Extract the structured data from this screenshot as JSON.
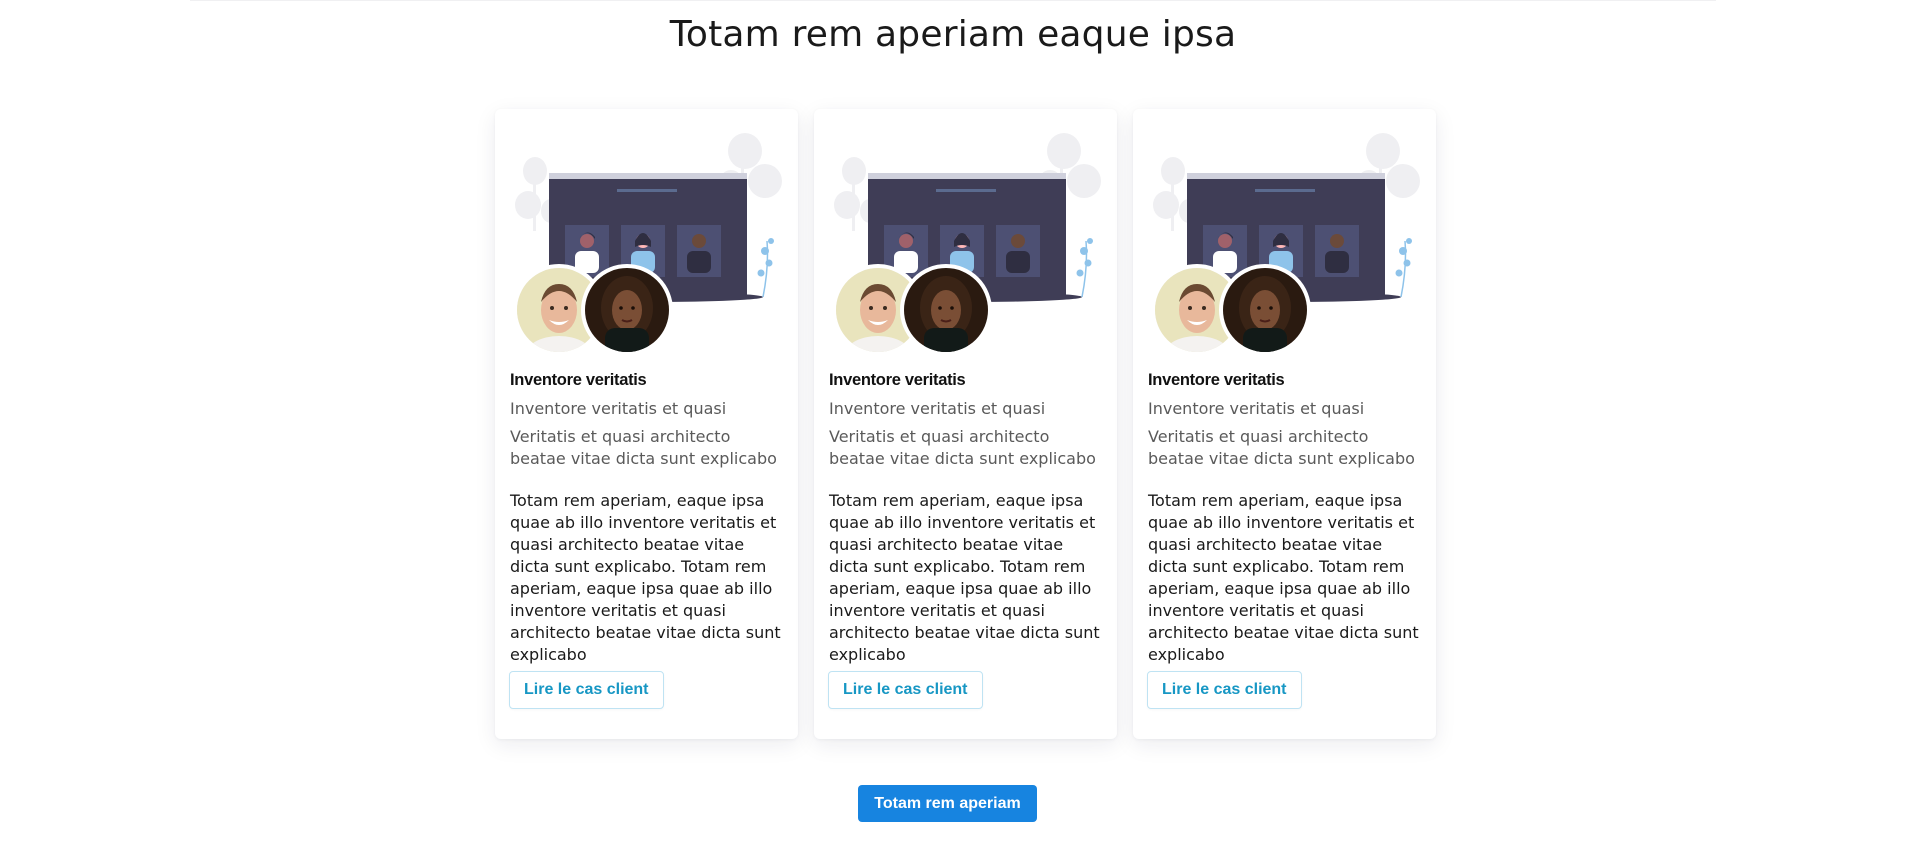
{
  "section": {
    "title": "Totam rem aperiam eaque ipsa"
  },
  "cards": [
    {
      "title": "Inventore veritatis",
      "subtitle": "Inventore veritatis et quasi",
      "tagline": "Veritatis et quasi architecto beatae vitae dicta sunt explicabo",
      "body": "Totam rem aperiam, eaque ipsa quae ab illo inventore veritatis et quasi architecto beatae vitae dicta sunt explicabo. Totam rem aperiam, eaque ipsa quae ab illo inventore veritatis et quasi architecto beatae vitae dicta sunt explicabo",
      "button_label": "Lire le cas client"
    },
    {
      "title": "Inventore veritatis",
      "subtitle": "Inventore veritatis et quasi",
      "tagline": "Veritatis et quasi architecto beatae vitae dicta sunt explicabo",
      "body": "Totam rem aperiam, eaque ipsa quae ab illo inventore veritatis et quasi architecto beatae vitae dicta sunt explicabo. Totam rem aperiam, eaque ipsa quae ab illo inventore veritatis et quasi architecto beatae vitae dicta sunt explicabo",
      "button_label": "Lire le cas client"
    },
    {
      "title": "Inventore veritatis",
      "subtitle": "Inventore veritatis et quasi",
      "tagline": "Veritatis et quasi architecto beatae vitae dicta sunt explicabo",
      "body": "Totam rem aperiam, eaque ipsa quae ab illo inventore veritatis et quasi architecto beatae vitae dicta sunt explicabo. Totam rem aperiam, eaque ipsa quae ab illo inventore veritatis et quasi architecto beatae vitae dicta sunt explicabo",
      "button_label": "Lire le cas client"
    }
  ],
  "primary_cta": {
    "label": "Totam rem aperiam"
  },
  "colors": {
    "card_button_text": "#1797c4",
    "card_button_border": "#bfe3f3",
    "primary_button_bg": "#1784e0",
    "illustration_screen": "#3f3d56"
  },
  "icons": {
    "illustration": "video-meeting-illustration",
    "avatar_1": "man-avatar-photo",
    "avatar_2": "woman-avatar-photo"
  }
}
